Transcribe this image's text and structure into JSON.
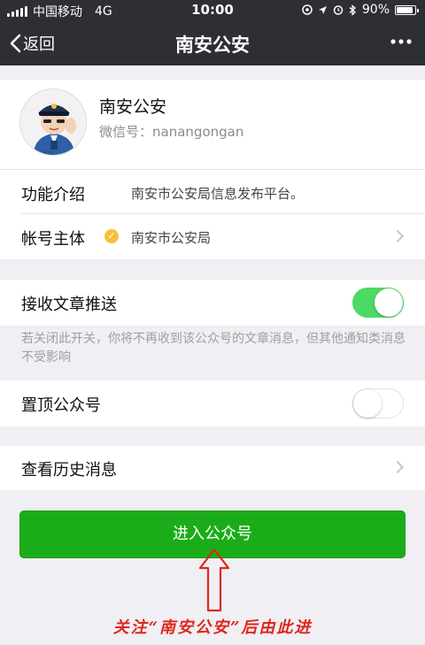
{
  "status_bar": {
    "carrier": "中国移动",
    "network": "4G",
    "time": "10:00",
    "battery": "90%",
    "battery_level": 0.9
  },
  "nav": {
    "back_label": "返回",
    "title": "南安公安",
    "more_icon": "more-icon"
  },
  "profile": {
    "name": "南安公安",
    "wechat_label": "微信号：",
    "wechat_id": "nanangongan",
    "avatar_icon": "police-avatar"
  },
  "info": {
    "intro_label": "功能介绍",
    "intro_value": "南安市公安局信息发布平台。",
    "entity_label": "帐号主体",
    "entity_value": "南安市公安局"
  },
  "settings": {
    "receive_label": "接收文章推送",
    "receive_on": true,
    "receive_note": "若关闭此开关，你将不再收到该公众号的文章消息，但其他通知类消息不受影响",
    "pin_label": "置顶公众号",
    "pin_on": false
  },
  "history": {
    "label": "查看历史消息"
  },
  "primary_button": {
    "label": "进入公众号",
    "color": "#1aad19"
  },
  "annotation": {
    "caption": "关注“南安公安”后由此进",
    "color": "#e0261c"
  }
}
